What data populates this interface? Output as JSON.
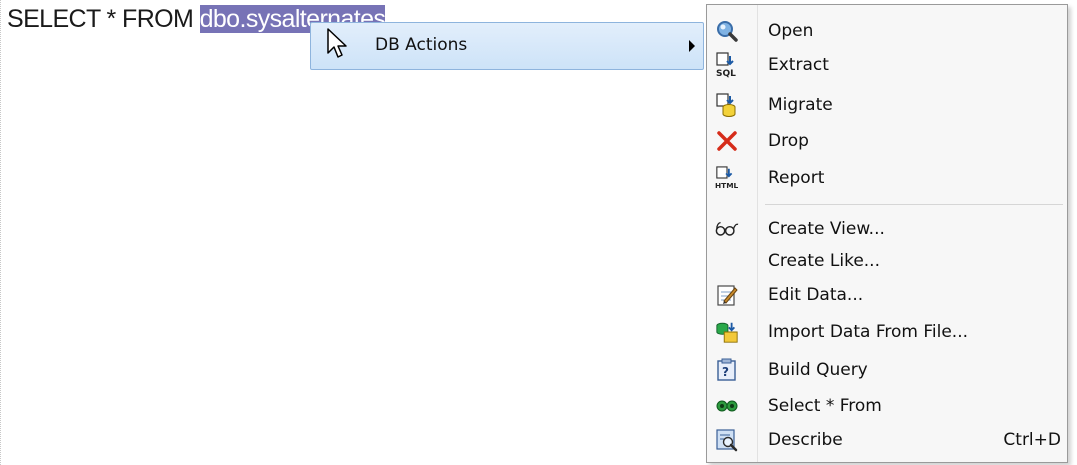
{
  "editor": {
    "sql_prefix": "SELECT * FROM ",
    "sql_selected": "dbo.sysalternates"
  },
  "submenu_item": {
    "label": "DB Actions",
    "has_arrow": true
  },
  "context_menu": {
    "items": [
      {
        "label": "Open",
        "icon": "magnifier-icon"
      },
      {
        "label": "Extract",
        "icon": "sql-extract-icon"
      },
      {
        "label": "Migrate",
        "icon": "migrate-icon"
      },
      {
        "label": "Drop",
        "icon": "red-x-icon"
      },
      {
        "label": "Report",
        "icon": "html-report-icon"
      },
      {
        "label": "Create View...",
        "icon": "glasses-icon"
      },
      {
        "label": "Create Like...",
        "icon": ""
      },
      {
        "label": "Edit Data...",
        "icon": "edit-data-icon"
      },
      {
        "label": "Import Data From File...",
        "icon": "import-data-icon"
      },
      {
        "label": "Build Query",
        "icon": "build-query-icon"
      },
      {
        "label": "Select * From",
        "icon": "select-from-icon"
      },
      {
        "label": "Describe",
        "icon": "describe-icon",
        "shortcut": "Ctrl+D"
      }
    ]
  },
  "colors": {
    "selection": "#7773b6",
    "submenu_highlight": "#cde3f8",
    "menu_background": "#f7f7f7"
  }
}
